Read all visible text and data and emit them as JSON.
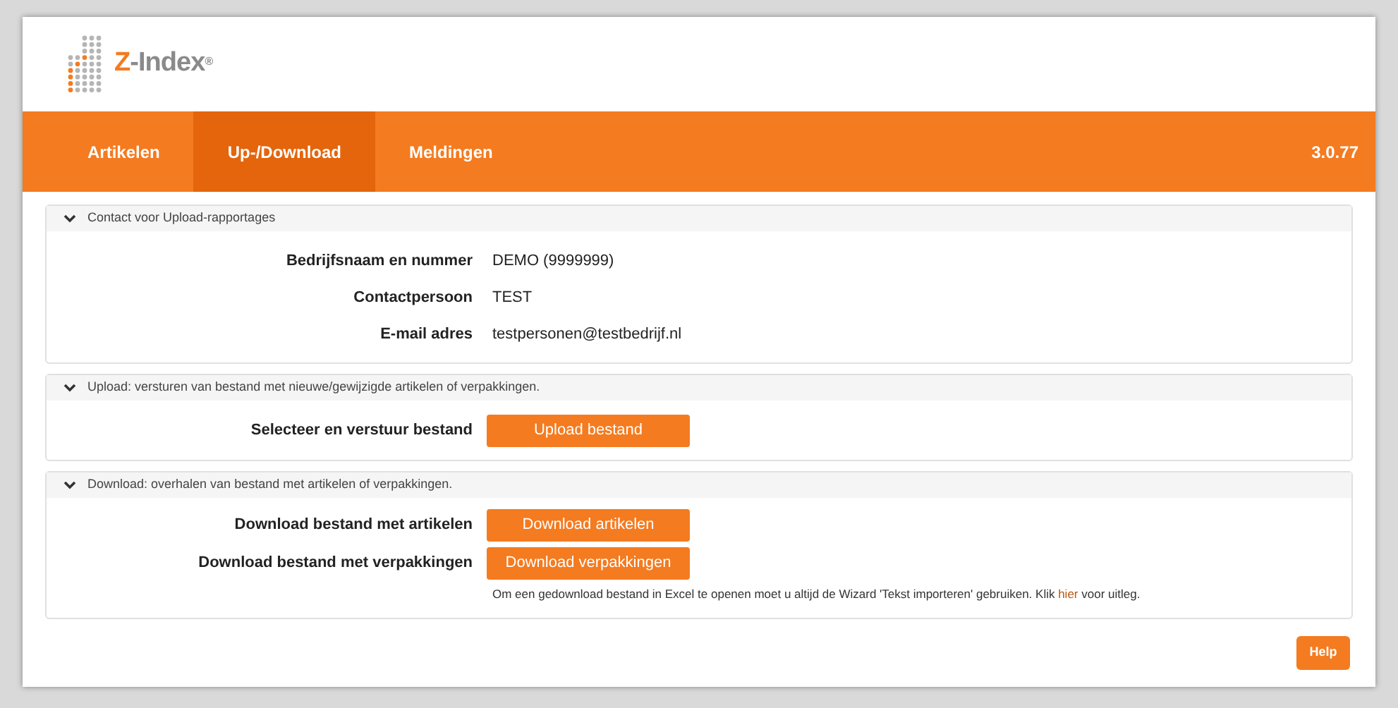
{
  "logo": {
    "text": "Z-Index",
    "mark": "®"
  },
  "nav": {
    "tabs": [
      {
        "label": "Artikelen",
        "selected": false
      },
      {
        "label": "Up-/Download",
        "selected": true
      },
      {
        "label": "Meldingen",
        "selected": false
      }
    ],
    "version": "3.0.77"
  },
  "sections": [
    {
      "title": "Contact voor Upload-rapportages",
      "expanded": true,
      "rows": [
        {
          "kind": "text",
          "label": "Bedrijfsnaam en nummer",
          "value": "DEMO (9999999)"
        },
        {
          "kind": "text",
          "label": "Contactpersoon",
          "value": "TEST"
        },
        {
          "kind": "text",
          "label": "E-mail adres",
          "value": "testpersonen@testbedrijf.nl"
        }
      ]
    },
    {
      "title": "Upload: versturen van bestand met nieuwe/gewijzigde artikelen of verpakkingen.",
      "expanded": true,
      "rows": [
        {
          "kind": "button",
          "label": "Selecteer en verstuur bestand",
          "value": "Upload bestand"
        }
      ]
    },
    {
      "title": "Download: overhalen van bestand met artikelen of verpakkingen.",
      "expanded": true,
      "rows": [
        {
          "kind": "button",
          "label": "Download bestand met artikelen",
          "value": "Download artikelen"
        },
        {
          "kind": "button",
          "label": "Download bestand met verpakkingen",
          "value": "Download verpakkingen"
        }
      ],
      "note": {
        "before": "Om een gedownload bestand in Excel te openen moet u altijd de Wizard 'Tekst importeren' gebruiken. Klik ",
        "link": "hier",
        "after": " voor uitleg."
      }
    }
  ],
  "help_button": "Help"
}
